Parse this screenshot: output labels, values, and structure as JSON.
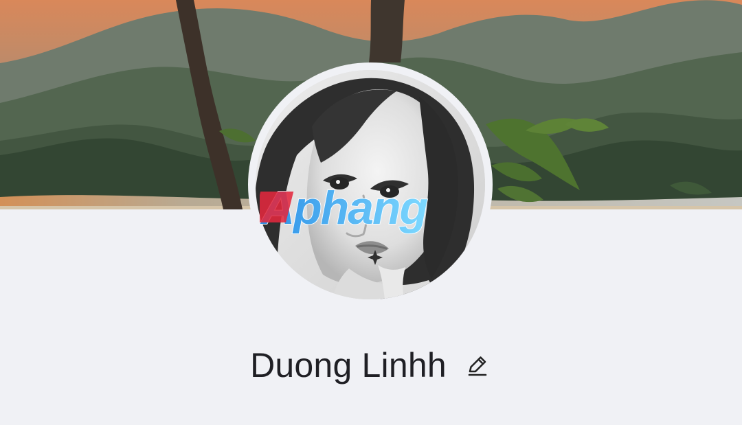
{
  "profile": {
    "name": "Duong Linhh"
  },
  "watermark": {
    "text": "Aphang"
  },
  "icons": {
    "edit": "pencil-icon"
  },
  "colors": {
    "background": "#f0f1f5",
    "name_text": "#1f1f24",
    "watermark_red": "#e3283d",
    "watermark_blue": "#2b8fe6"
  }
}
